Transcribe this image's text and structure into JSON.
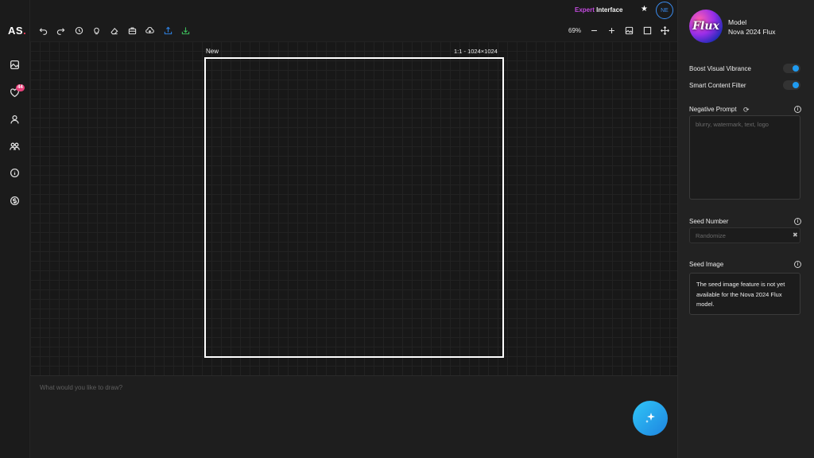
{
  "app": {
    "logo_text": "AS",
    "logo_dot": ".",
    "favorites_badge": "44"
  },
  "header": {
    "interface_prefix": "Expert",
    "interface_suffix": " Interface",
    "avatar_initials": "NE",
    "zoom_level": "69%"
  },
  "icons": {
    "rail": [
      "image-icon",
      "heart-icon",
      "user-icon",
      "users-icon",
      "info-icon",
      "dollar-icon"
    ],
    "toolbar": [
      "undo-icon",
      "redo-icon",
      "history-icon",
      "lightbulb-icon",
      "eraser-icon",
      "briefcase-icon",
      "cloud-upload-icon",
      "upload-icon",
      "download-icon"
    ],
    "toolbar_colors": {
      "upload": "#2d7fe0",
      "download": "#3cba5a"
    }
  },
  "canvas": {
    "frame_label": "New",
    "frame_size": "1:1 - 1024×1024"
  },
  "prompt": {
    "placeholder": "What would you like to draw?"
  },
  "panel": {
    "model_label": "Model",
    "model_name": "Nova 2024 Flux",
    "model_thumb_text": "Flux",
    "toggle_vibrance": "Boost Visual Vibrance",
    "toggle_filter": "Smart Content Filter",
    "negative_label": "Negative Prompt",
    "negative_placeholder": "blurry, watermark, text, logo",
    "seed_label": "Seed Number",
    "seed_placeholder": "Randomize",
    "seed_image_label": "Seed Image",
    "seed_image_note": "The seed image feature is not yet available for the Nova 2024 Flux model."
  },
  "colors": {
    "accent_blue": "#1f9bf0",
    "expert_purple": "#c34bdf",
    "badge_pink": "#e7417a"
  }
}
